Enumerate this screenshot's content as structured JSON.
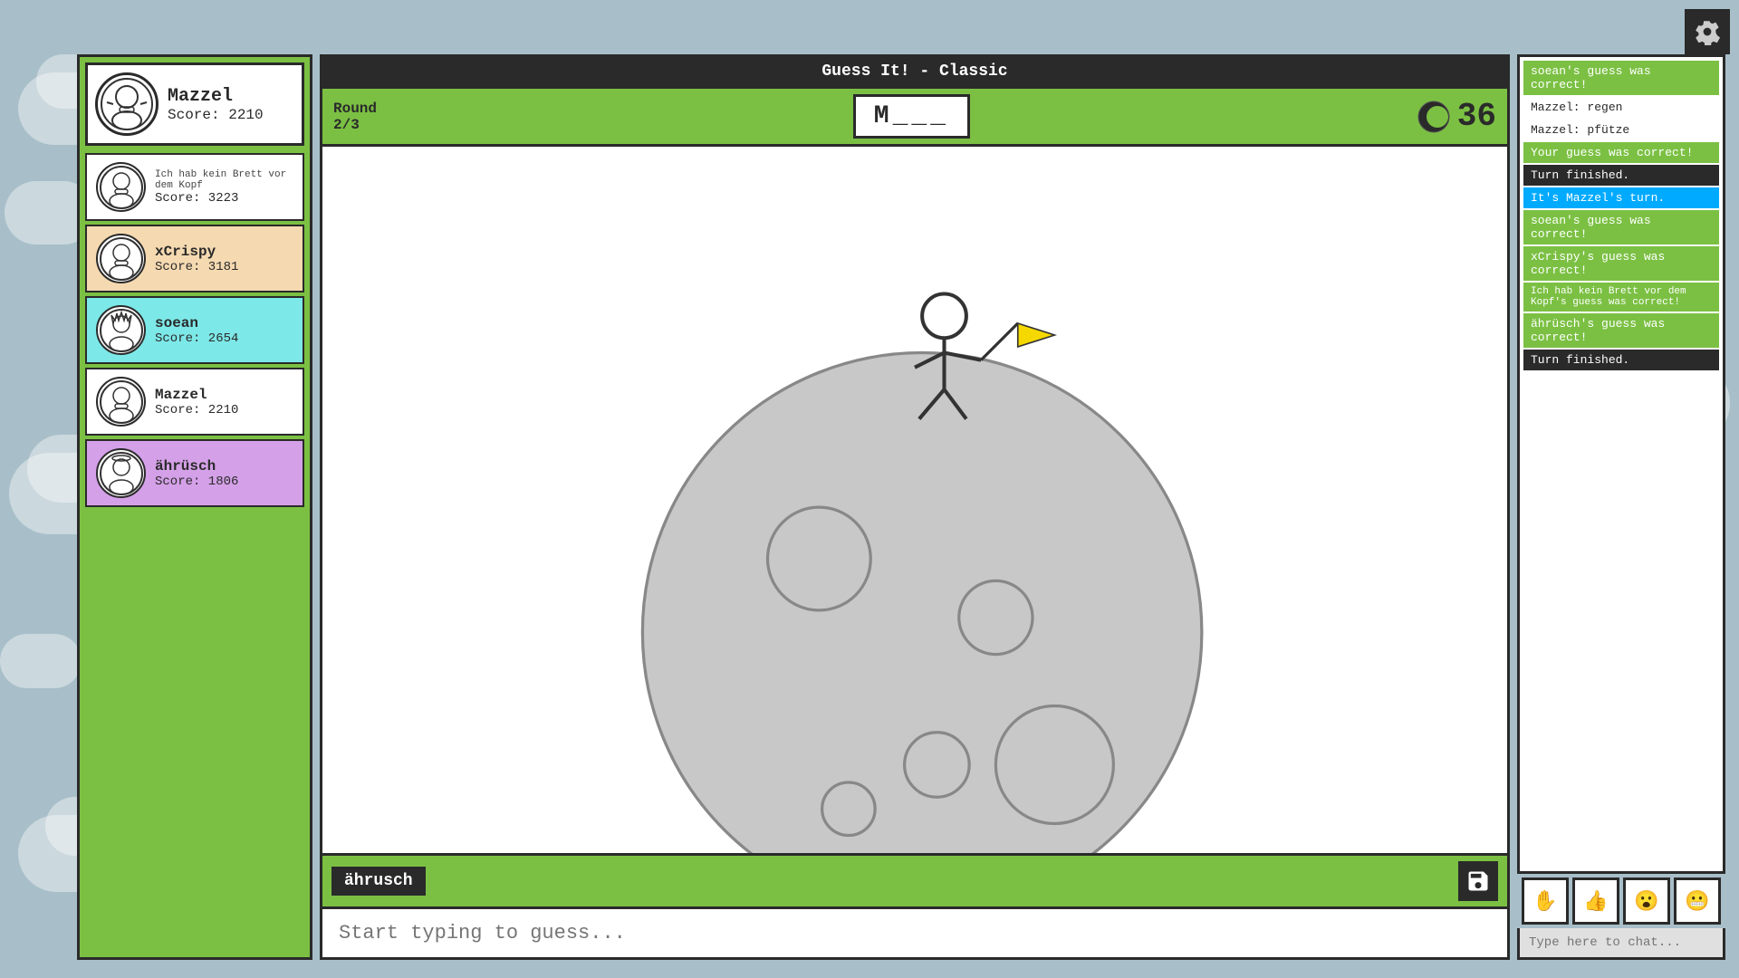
{
  "game": {
    "title": "Guess It! - Classic",
    "round_label": "Round",
    "round_current": "2/3",
    "word": "M___",
    "timer": "36",
    "drawer_name": "ährusch",
    "guess_placeholder": "Start typing to guess...",
    "chat_placeholder": "Type here to chat..."
  },
  "players": [
    {
      "name": "Mazzel",
      "score_label": "Score: 2210",
      "is_current": true,
      "bg": "white"
    },
    {
      "name": "Ich hab kein Brett vor dem Kopf",
      "score_label": "Score: 3223",
      "bg": "white",
      "avatar_char": "👤"
    },
    {
      "name": "xCrispy",
      "score_label": "Score: 3181",
      "bg": "xcrispy",
      "avatar_char": "👤"
    },
    {
      "name": "soean",
      "score_label": "Score: 2654",
      "bg": "soean",
      "avatar_char": "👤"
    },
    {
      "name": "Mazzel",
      "score_label": "Score: 2210",
      "bg": "white",
      "avatar_char": "👤"
    },
    {
      "name": "ährüsch",
      "score_label": "Score: 1806",
      "bg": "ahruesch",
      "avatar_char": "👤"
    }
  ],
  "chat": {
    "messages": [
      {
        "type": "correct",
        "text": "soean's guess was correct!"
      },
      {
        "type": "regular",
        "text": "Mazzel: regen"
      },
      {
        "type": "regular",
        "text": "Mazzel: pfütze"
      },
      {
        "type": "correct",
        "text": "Your guess was correct!"
      },
      {
        "type": "turn-finished",
        "text": "Turn finished."
      },
      {
        "type": "its-turn",
        "text": "It's Mazzel's turn."
      },
      {
        "type": "correct",
        "text": "soean's guess was correct!"
      },
      {
        "type": "correct",
        "text": "xCrispy's guess was correct!"
      },
      {
        "type": "correct",
        "text": "Ich hab kein Brett vor dem Kopf's guess was correct!"
      },
      {
        "type": "correct",
        "text": "ährüsch's guess was correct!"
      },
      {
        "type": "turn-finished",
        "text": "Turn finished."
      }
    ]
  },
  "reactions": [
    {
      "icon": "✋",
      "name": "hand-reaction"
    },
    {
      "icon": "👍",
      "name": "thumbsup-reaction"
    },
    {
      "icon": "😮",
      "name": "wow-reaction"
    },
    {
      "icon": "😬",
      "name": "oops-reaction"
    }
  ],
  "icons": {
    "settings": "⚙",
    "save": "💾",
    "timer": "🌙"
  }
}
